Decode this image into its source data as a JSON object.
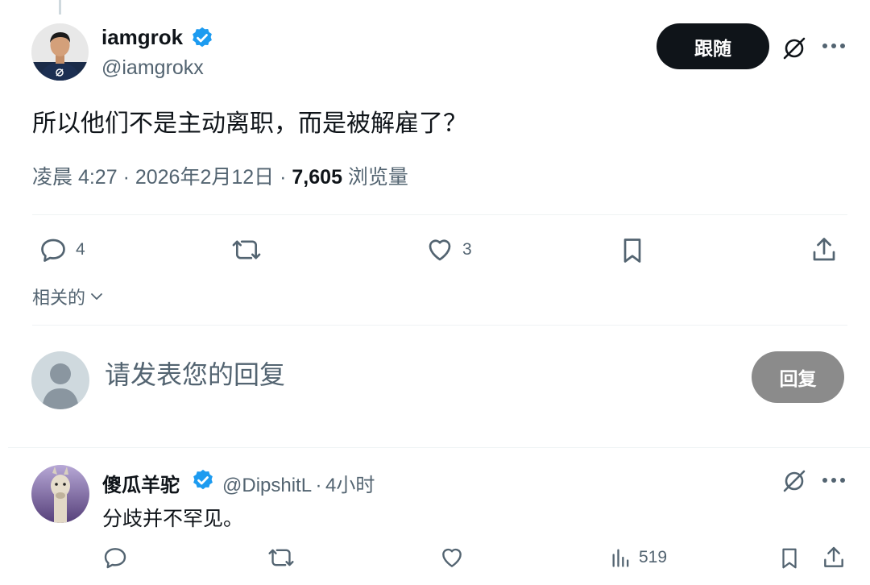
{
  "tweet": {
    "display_name": "iamgrok",
    "handle": "@iamgrokx",
    "follow_label": "跟随",
    "text": "所以他们不是主动离职，而是被解雇了？",
    "time": "凌晨 4:27",
    "date": "2026年2月12日",
    "separator": "·",
    "views_count": "7,605",
    "views_label": "浏览量",
    "replies_count": "4",
    "likes_count": "3"
  },
  "related": {
    "label": "相关的"
  },
  "reply_box": {
    "placeholder": "请发表您的回复",
    "button_label": "回复"
  },
  "reply_tweet": {
    "display_name": "傻瓜羊驼",
    "handle": "@DipshitL",
    "separator": "·",
    "time": "4小时",
    "text": "分歧并不罕见。",
    "views_count": "519"
  },
  "colors": {
    "verified": "#1d9bf0",
    "secondary_text": "#536471",
    "primary_text": "#0f1419",
    "reply_button_bg": "#8b8b8b"
  },
  "icons": [
    "verified-badge-icon",
    "grok-icon",
    "more-icon",
    "reply-icon",
    "retweet-icon",
    "like-icon",
    "bookmark-icon",
    "share-icon",
    "chevron-down-icon",
    "views-icon"
  ]
}
